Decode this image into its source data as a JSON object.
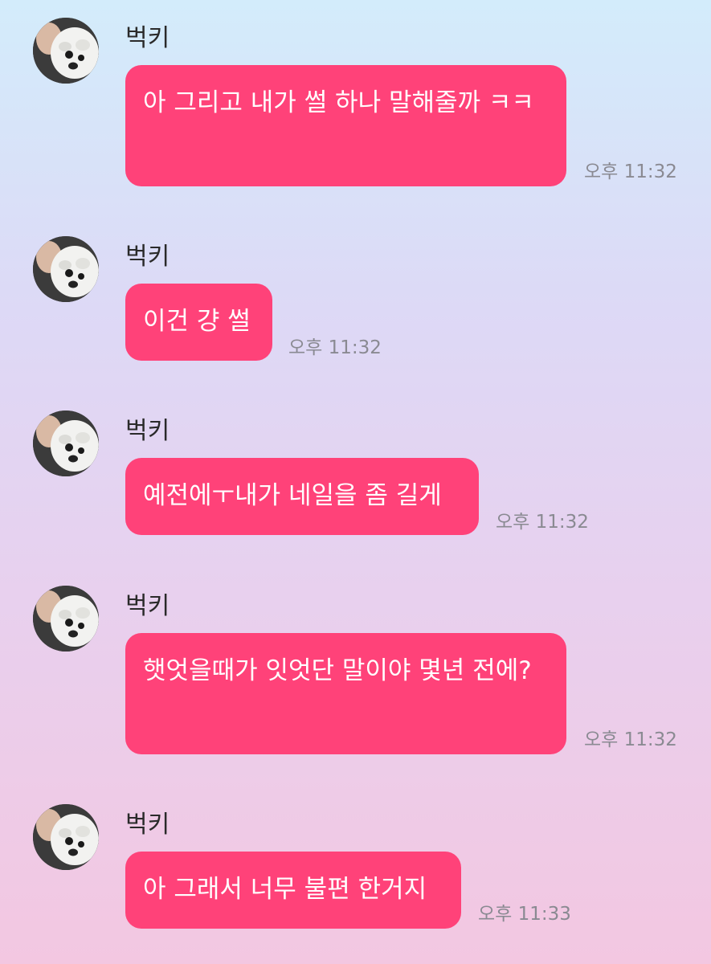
{
  "messages": [
    {
      "sender": "벅키",
      "text": "아 그리고 내가 썰 하나 말해줄까 ㅋㅋ",
      "time": "오후 11:32"
    },
    {
      "sender": "벅키",
      "text": "이건 걍 썰",
      "time": "오후 11:32"
    },
    {
      "sender": "벅키",
      "text": "예전에ㅜ내가 네일을 좀 길게",
      "time": "오후 11:32"
    },
    {
      "sender": "벅키",
      "text": "햇엇을때가 잇엇단 말이야 몇년 전에?",
      "time": "오후 11:32"
    },
    {
      "sender": "벅키",
      "text": "아 그래서 너무 불편 한거지",
      "time": "오후 11:33"
    }
  ],
  "icons": {
    "avatar": "dog-avatar-icon"
  },
  "colors": {
    "bubble": "#ff4279",
    "bubble_text": "#ffffff",
    "timestamp": "#8a8a92",
    "sender": "#2a2a2a",
    "background_top": "#d3ecfb",
    "background_bottom": "#f3c7e1"
  }
}
